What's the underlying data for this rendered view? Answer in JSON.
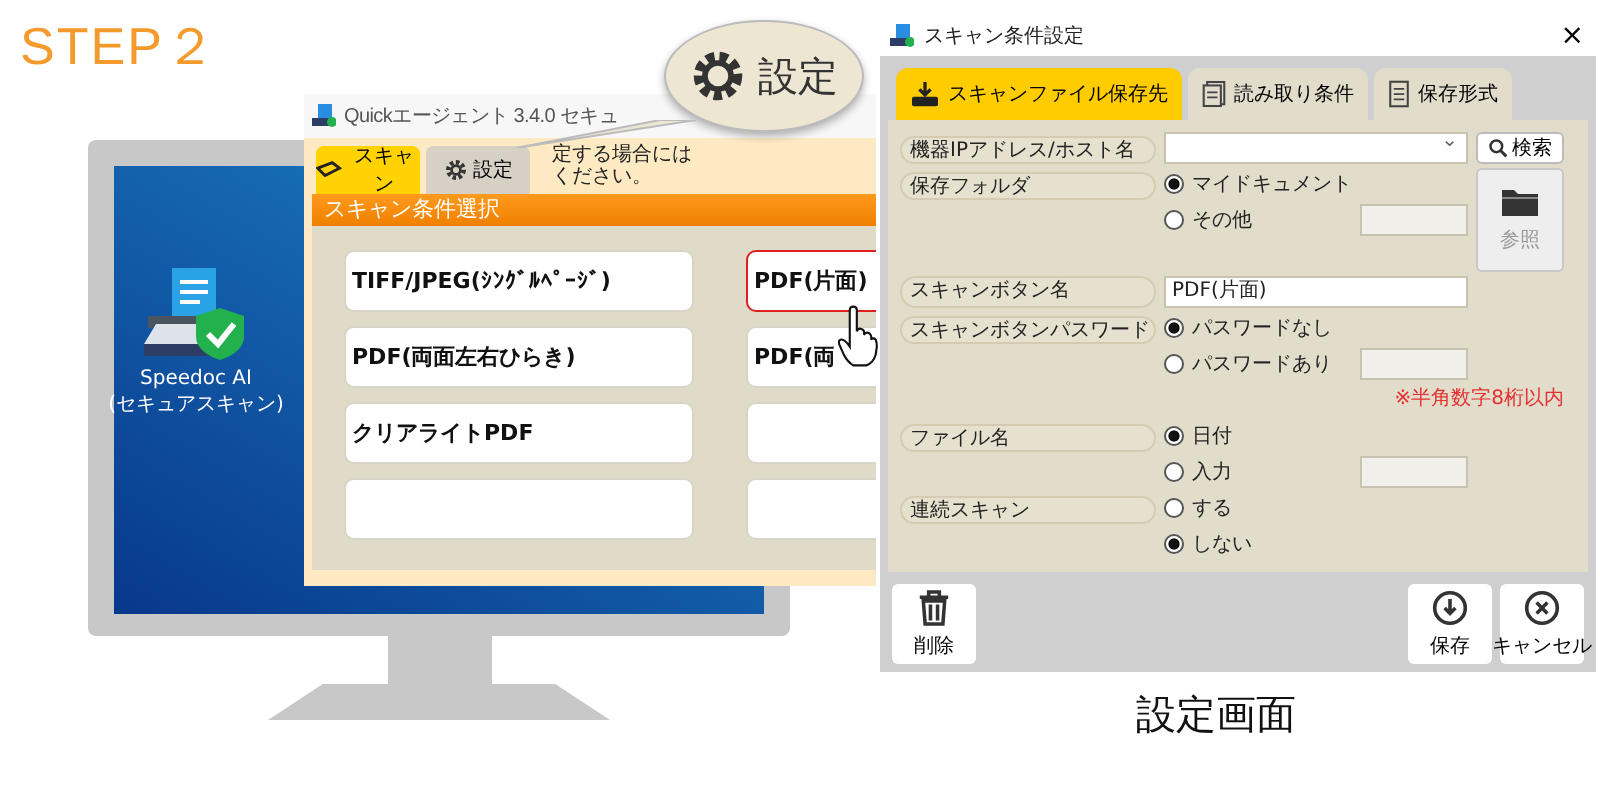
{
  "step_label": "STEP２",
  "desktop": {
    "icon_label": [
      "Speedoc AI",
      "(セキュアスキャン)"
    ]
  },
  "app_window": {
    "title": "Quickエージェント 3.4.0 セキュ",
    "tabs": [
      {
        "label": "スキャン",
        "selected": true
      },
      {
        "label": "設定",
        "selected": false
      }
    ],
    "hint_lines": [
      "定する場合には",
      "ください。"
    ],
    "section_header": "スキャン条件選択",
    "scan_buttons": [
      {
        "label": "TIFF/JPEG(ｼﾝｸﾞﾙﾍﾟｰｼﾞ)",
        "selected": false
      },
      {
        "label": "PDF(片面)",
        "selected": true
      },
      {
        "label": "PDF(両面左右ひらき)",
        "selected": false
      },
      {
        "label": "PDF(両",
        "selected": false
      },
      {
        "label": "クリアライトPDF",
        "selected": false
      },
      {
        "selected": false
      },
      {
        "selected": false
      },
      {
        "selected": false
      }
    ]
  },
  "callout": {
    "label": "設定"
  },
  "dialog": {
    "title": "スキャン条件設定",
    "close": "×",
    "tabs": [
      {
        "label": "スキャンファイル保存先",
        "selected": true,
        "kind": "tray"
      },
      {
        "label": "読み取り条件",
        "selected": false,
        "kind": "pages"
      },
      {
        "label": "保存形式",
        "selected": false,
        "kind": "list"
      }
    ],
    "ip_address": {
      "label": "機器IPアドレス/ホスト名",
      "caret": "⌄"
    },
    "search_button": "検索",
    "browse_button": {
      "label": "参照",
      "disabled": true
    },
    "save_folder": {
      "label": "保存フォルダ",
      "options": [
        {
          "label": "マイドキュメント",
          "selected": true
        },
        {
          "label": "その他",
          "selected": false
        }
      ]
    },
    "button_name": {
      "label": "スキャンボタン名",
      "value": "PDF(片面)"
    },
    "password": {
      "label": "スキャンボタンパスワード",
      "options": [
        {
          "label": "パスワードなし",
          "selected": true
        },
        {
          "label": "パスワードあり",
          "selected": false
        }
      ],
      "note": "※半角数字8桁以内"
    },
    "file_name": {
      "label": "ファイル名",
      "options": [
        {
          "label": "日付",
          "selected": true
        },
        {
          "label": "入力",
          "selected": false
        }
      ]
    },
    "continuous_scan": {
      "label": "連続スキャン",
      "options": [
        {
          "label": "する",
          "selected": false
        },
        {
          "label": "しない",
          "selected": true
        }
      ]
    },
    "actions": [
      {
        "label": "削除",
        "kind": "delete"
      },
      {
        "label": "保存",
        "kind": "save"
      },
      {
        "label": "キャンセル",
        "kind": "cancel"
      }
    ]
  },
  "caption": "設定画面"
}
